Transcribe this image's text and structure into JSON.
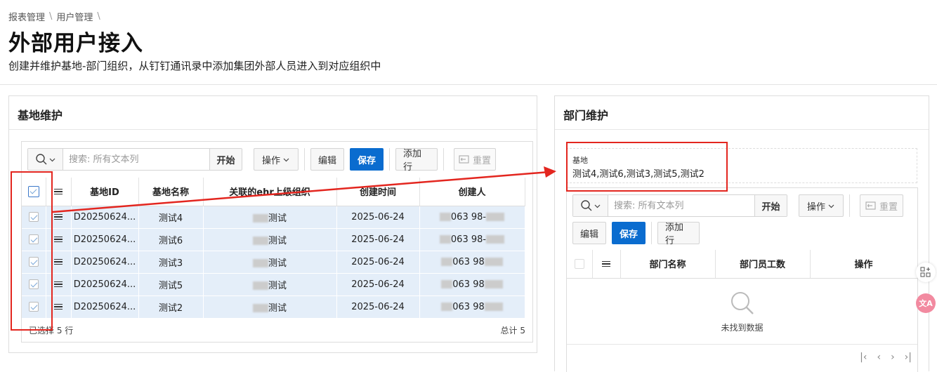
{
  "breadcrumb": {
    "items": [
      "报表管理",
      "用户管理"
    ],
    "separator": "\\"
  },
  "page": {
    "title": "外部用户接入",
    "subtitle": "创建并维护基地-部门组织，从钉钉通讯录中添加集团外部人员进入到对应组织中"
  },
  "left": {
    "title": "基地维护",
    "search_placeholder": "搜索: 所有文本列",
    "go_label": "开始",
    "actions_label": "操作",
    "edit_label": "编辑",
    "save_label": "保存",
    "add_row_label": "添加行",
    "reset_label": "重置",
    "columns": [
      "基地ID",
      "基地名称",
      "关联的ehr上级组织",
      "创建时间",
      "创建人"
    ],
    "rows": [
      {
        "id": "D20250624...",
        "name": "测试4",
        "org": "测试",
        "date": "2025-06-24",
        "creator": "063 98-"
      },
      {
        "id": "D20250624...",
        "name": "测试6",
        "org": "测试",
        "date": "2025-06-24",
        "creator": "063 98-"
      },
      {
        "id": "D20250624...",
        "name": "测试3",
        "org": "测试",
        "date": "2025-06-24",
        "creator": "063 98"
      },
      {
        "id": "D20250624...",
        "name": "测试5",
        "org": "测试",
        "date": "2025-06-24",
        "creator": "063 98"
      },
      {
        "id": "D20250624...",
        "name": "测试2",
        "org": "测试",
        "date": "2025-06-24",
        "creator": "063 98"
      }
    ],
    "selected_text": "已选择 5 行",
    "total_text": "总计 5"
  },
  "right": {
    "title": "部门维护",
    "field_label": "基地",
    "field_value": "测试4,测试6,测试3,测试5,测试2",
    "search_placeholder": "搜索: 所有文本列",
    "go_label": "开始",
    "actions_label": "操作",
    "reset_label": "重置",
    "edit_label": "编辑",
    "save_label": "保存",
    "add_row_label": "添加行",
    "columns": [
      "部门名称",
      "部门员工数",
      "操作"
    ],
    "no_data": "未找到数据"
  },
  "colors": {
    "primary": "#0a6ccf",
    "selected_row": "#e4eef9",
    "annotation": "#e3261f"
  }
}
